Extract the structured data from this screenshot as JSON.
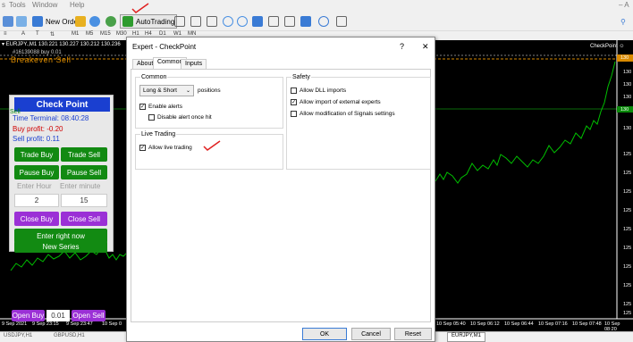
{
  "menu": {
    "items": [
      "s",
      "Tools",
      "Window",
      "Help"
    ],
    "right": "– A"
  },
  "toolbar": {
    "new_order": "New Order",
    "autotrading": "AutoTrading",
    "timeframes": [
      "M1",
      "M5",
      "M15",
      "M30",
      "H1",
      "H4",
      "D1",
      "W1",
      "MN"
    ]
  },
  "chart": {
    "title": "▾ EURJPY.,M1  130.221 130.227 130.212 130.236",
    "order_line": "#16139088 buy 0.01",
    "breakeven": "Breakeven Sell",
    "chart_label": "CheckPoint ☺",
    "time_axis_left": [
      "9 Sep 2021",
      "9 Sep 23:15",
      "9 Sep 23:47",
      "10 Sep 0"
    ],
    "time_axis_right": [
      "10 Sep 05:40",
      "10 Sep 06:12",
      "10 Sep 06:44",
      "10 Sep 07:16",
      "10 Sep 07:48",
      "10 Sep 08:20"
    ],
    "price_labels": [
      "130",
      "130",
      "130",
      "130",
      "130",
      "130",
      "125",
      "125",
      "125",
      "125",
      "125",
      "125",
      "125",
      "125",
      "125",
      "125",
      "125"
    ],
    "colors": {
      "background": "#000000",
      "candles": "#00c000",
      "breakeven": "#ff8c00",
      "grid_green": "#006400"
    }
  },
  "panel": {
    "title": "Check Point",
    "sell_label": "Sell",
    "time": "Time Terminal: 08:40:28",
    "buy_profit": "Buy profit: -0.20",
    "sell_profit": "Sell profit: 0.11",
    "trade_buy": "Trade Buy",
    "trade_sell": "Trade Sell",
    "pause_buy": "Pause Buy",
    "pause_sell": "Pause Sell",
    "enter_hour_label": "Enter Hour",
    "enter_minute_label": "Enter minute",
    "enter_hour_value": "2",
    "enter_minute_value": "15",
    "close_buy": "Close Buy",
    "close_sell": "Close Sell",
    "enter_right_now": "Enter right now",
    "new_series": "New Series",
    "open_buy": "Open Buy",
    "lot": "0.01",
    "open_sell": "Open Sell"
  },
  "dialog": {
    "title": "Expert - CheckPoint",
    "help": "?",
    "close": "✕",
    "tabs": [
      "About",
      "Common",
      "Inputs"
    ],
    "common": {
      "title": "Common",
      "direction": "Long & Short",
      "positions": "positions",
      "enable_alerts": "Enable alerts",
      "disable_alert": "Disable alert once hit"
    },
    "live": {
      "title": "Live Trading",
      "allow_live": "Allow live trading"
    },
    "safety": {
      "title": "Safety",
      "allow_dll": "Allow DLL imports",
      "allow_import": "Allow import of external experts",
      "allow_modification": "Allow modification of Signals settings"
    },
    "ok": "OK",
    "cancel": "Cancel",
    "reset": "Reset"
  },
  "status": {
    "tabs": [
      "USDJPY,H1",
      "GBPUSD,H1",
      "EURJPY,M1"
    ]
  }
}
